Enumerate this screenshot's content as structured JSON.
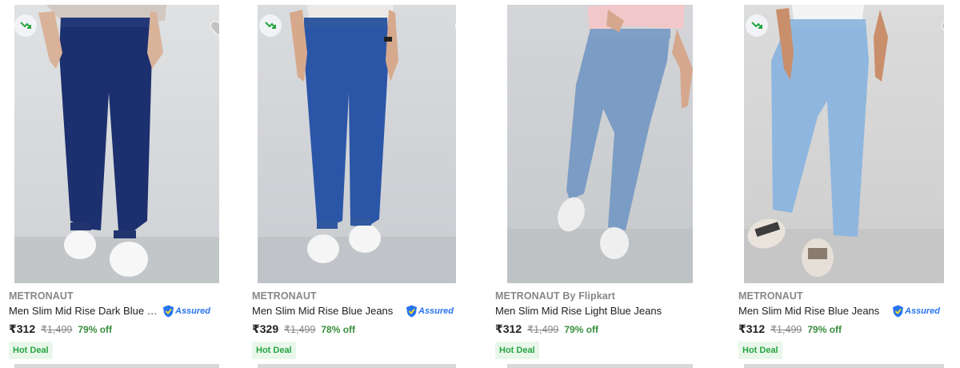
{
  "products": [
    {
      "brand": "METRONAUT",
      "title": "Men Slim Mid Rise Dark Blue Je...",
      "price": "₹312",
      "mrp": "₹1,499",
      "off": "79% off",
      "deal": "Hot Deal",
      "assured": "Assured",
      "trending": true,
      "image_icon": "jeans-dark-blue-image"
    },
    {
      "brand": "METRONAUT",
      "title": "Men Slim Mid Rise Blue Jeans",
      "price": "₹329",
      "mrp": "₹1,499",
      "off": "78% off",
      "deal": "Hot Deal",
      "assured": "Assured",
      "trending": true,
      "image_icon": "jeans-blue-image"
    },
    {
      "brand": "METRONAUT By Flipkart",
      "title": "Men Slim Mid Rise Light Blue Jeans",
      "price": "₹312",
      "mrp": "₹1,499",
      "off": "79% off",
      "deal": "Hot Deal",
      "assured": "",
      "trending": false,
      "image_icon": "jeans-light-blue-image"
    },
    {
      "brand": "METRONAUT",
      "title": "Men Slim Mid Rise Blue Jeans",
      "price": "₹312",
      "mrp": "₹1,499",
      "off": "79% off",
      "deal": "Hot Deal",
      "assured": "Assured",
      "trending": true,
      "image_icon": "jeans-faded-blue-image"
    }
  ],
  "colors": {
    "price_discount": "#388e3c",
    "deal_text": "#26a541",
    "deal_bg": "#e9f7ea",
    "assured_blue": "#2874f0",
    "brand_gray": "#878787",
    "wishlist_gray": "#c2c2c2"
  }
}
